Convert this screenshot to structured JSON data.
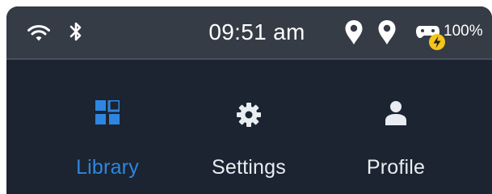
{
  "status_bar": {
    "time": "09:51 am",
    "battery_percent": "100%",
    "icons": {
      "wifi": "wifi-icon",
      "bluetooth": "bluetooth-icon",
      "location_1": "location-pin-icon",
      "location_2": "location-pin-icon",
      "controller": "controller-charging-icon"
    },
    "charging_badge_color": "#f5c518"
  },
  "nav": {
    "active": "library",
    "items": [
      {
        "id": "library",
        "label": "Library",
        "icon": "grid-icon",
        "active": true
      },
      {
        "id": "settings",
        "label": "Settings",
        "icon": "gear-icon",
        "active": false
      },
      {
        "id": "profile",
        "label": "Profile",
        "icon": "person-icon",
        "active": false
      }
    ]
  },
  "colors": {
    "status_bar_bg": "#353c46",
    "nav_bg": "#1b2430",
    "accent": "#2f86e0",
    "text": "#e9edf2"
  }
}
